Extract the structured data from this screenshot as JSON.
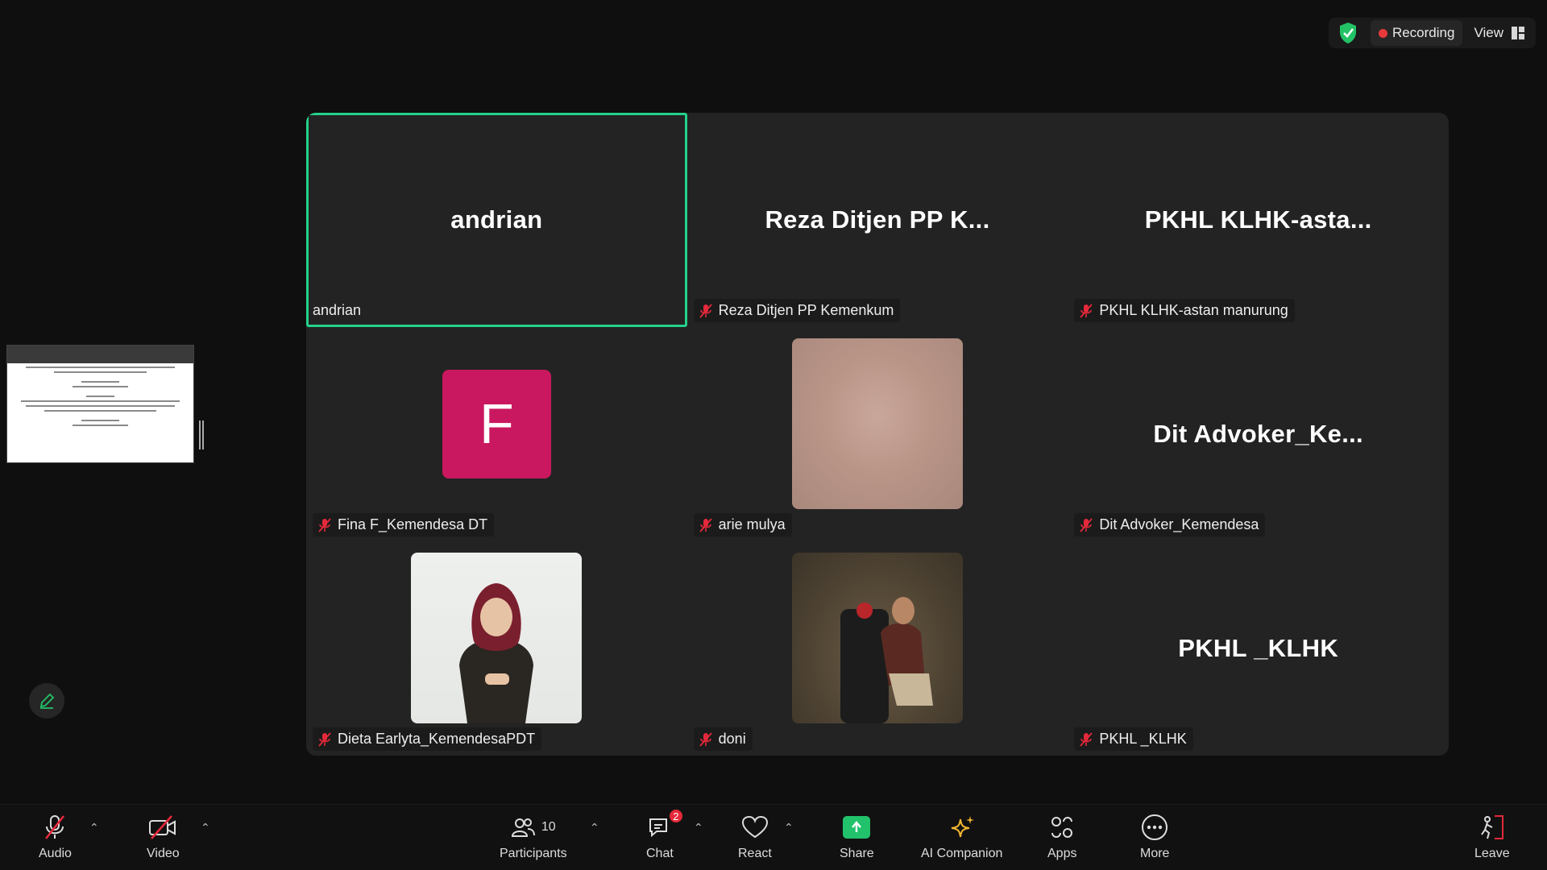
{
  "status": {
    "recording_label": "Recording",
    "view_label": "View"
  },
  "tiles": [
    {
      "big_name": "andrian",
      "label": "andrian"
    },
    {
      "big_name": "Reza Ditjen PP K...",
      "label": "Reza Ditjen PP Kemenkum"
    },
    {
      "big_name": "PKHL  KLHK-asta...",
      "label": "PKHL KLHK-astan manurung"
    },
    {
      "avatar_letter": "F",
      "label": "Fina F_Kemendesa DT"
    },
    {
      "label": "arie mulya"
    },
    {
      "big_name": "Dit  Advoker_Ke...",
      "label": "Dit Advoker_Kemendesa"
    },
    {
      "label": "Dieta Earlyta_KemendesaPDT"
    },
    {
      "label": "doni"
    },
    {
      "big_name": "PKHL _KLHK",
      "label": "PKHL _KLHK"
    }
  ],
  "toolbar": {
    "audio": "Audio",
    "video": "Video",
    "participants": "Participants",
    "participants_count": "10",
    "chat": "Chat",
    "chat_badge": "2",
    "react": "React",
    "share": "Share",
    "ai_companion": "AI Companion",
    "apps": "Apps",
    "more": "More",
    "leave": "Leave"
  },
  "colors": {
    "active_speaker": "#23d28a",
    "avatar_bg": "#c9185f",
    "recording_dot": "#e83a3a",
    "share_green": "#21c26b",
    "mute_red": "#e5293a"
  }
}
